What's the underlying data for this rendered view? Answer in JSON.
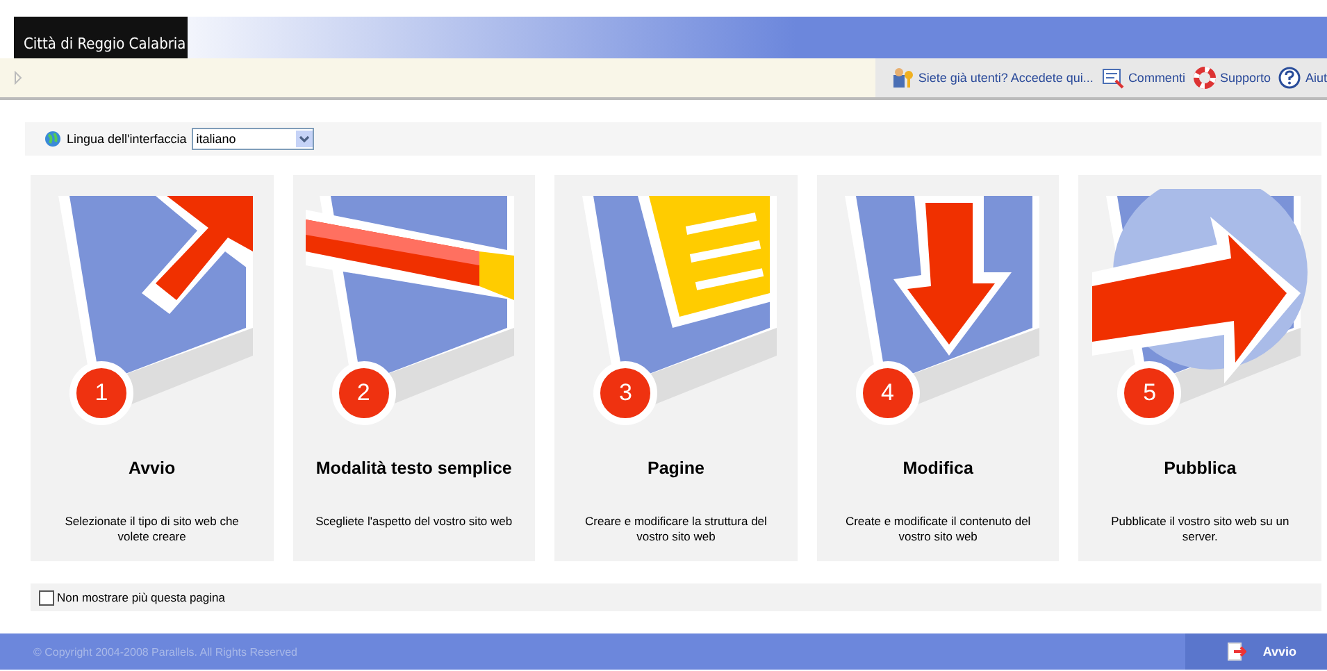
{
  "header": {
    "logo_text": "Città di Reggio Calabria"
  },
  "toolbar": {
    "links": [
      {
        "kind": "login",
        "label": "Siete già utenti? Accedete qui..."
      },
      {
        "kind": "comments",
        "label": "Commenti"
      },
      {
        "kind": "support",
        "label": "Supporto"
      },
      {
        "kind": "help",
        "label": "Aiut"
      }
    ]
  },
  "language": {
    "label": "Lingua dell'interfaccia",
    "value": "italiano"
  },
  "steps": [
    {
      "number": "1",
      "title": "Avvio",
      "description": "Selezionate il tipo di sito web che volete creare"
    },
    {
      "number": "2",
      "title": "Modalità testo semplice",
      "description": "Scegliete l'aspetto del vostro sito web"
    },
    {
      "number": "3",
      "title": "Pagine",
      "description": "Creare e modificare la struttura del vostro sito web"
    },
    {
      "number": "4",
      "title": "Modifica",
      "description": "Create e modificate il contenuto del vostro sito web"
    },
    {
      "number": "5",
      "title": "Pubblica",
      "description": "Pubblicate il vostro sito web su un server."
    }
  ],
  "dont_show": {
    "label": "Non mostrare più questa pagina",
    "checked": false
  },
  "footer": {
    "copyright": "© Copyright 2004-2008 Parallels. All Rights Reserved",
    "next_button": "Avvio"
  }
}
